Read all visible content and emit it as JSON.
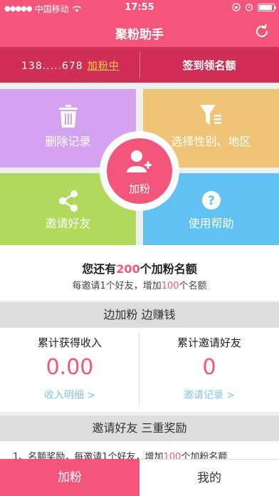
{
  "status_bar": {
    "carrier": "中国移动",
    "time": "17:55"
  },
  "nav": {
    "title": "聚粉助手",
    "refresh_icon": "refresh-icon"
  },
  "account": {
    "phone": "138.....678",
    "status_link": "加粉中",
    "sign_in": "签到领名额"
  },
  "tiles": {
    "delete": {
      "label": "删除记录",
      "icon": "trash-icon",
      "color": "#d3a2f1"
    },
    "filter": {
      "label": "选择性别、地区",
      "icon": "filter-icon",
      "color": "#efc477"
    },
    "invite": {
      "label": "邀请好友",
      "icon": "share-icon",
      "color": "#b0da5c"
    },
    "help": {
      "label": "使用帮助",
      "icon": "question-icon",
      "color": "#60c1f2"
    },
    "add": {
      "label": "加粉",
      "icon": "add-user-icon",
      "color": "#f3567a"
    }
  },
  "quota": {
    "prefix": "您还有",
    "count": "200",
    "suffix": "个加粉名额",
    "sub_prefix": "每邀请1个好友，增加",
    "sub_count": "100",
    "sub_suffix": "个名额"
  },
  "band1": "边加粉 边赚钱",
  "stats": {
    "income_title": "累计获得收入",
    "income_value": "0.00",
    "income_link": "收入明细 >",
    "friends_title": "累计邀请好友",
    "friends_value": "0",
    "friends_link": "邀请记录 >"
  },
  "band2": "邀请好友 三重奖励",
  "rule1": {
    "prefix": "1、名额奖励，每邀请1个好友，增加",
    "count": "100",
    "suffix": "个加粉名额"
  },
  "tabs": {
    "add": "加粉",
    "mine": "我的"
  },
  "colors": {
    "accent": "#f3567a",
    "account_bar": "#d12e55",
    "link_yellow": "#ffd14a",
    "link_blue": "#86c4ea"
  }
}
